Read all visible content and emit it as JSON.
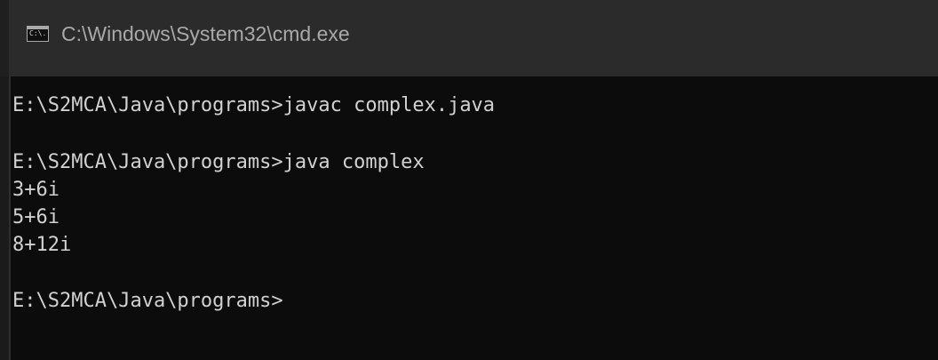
{
  "window": {
    "title": "C:\\Windows\\System32\\cmd.exe",
    "icon_text": "C:\\.",
    "icon_name": "cmd-icon"
  },
  "terminal": {
    "lines": [
      "E:\\S2MCA\\Java\\programs>javac complex.java",
      "E:\\S2MCA\\Java\\programs>java complex",
      "3+6i",
      "5+6i",
      "8+12i",
      "E:\\S2MCA\\Java\\programs>"
    ],
    "background_color": "#0c0c0c",
    "text_color": "#d1d1d1"
  }
}
